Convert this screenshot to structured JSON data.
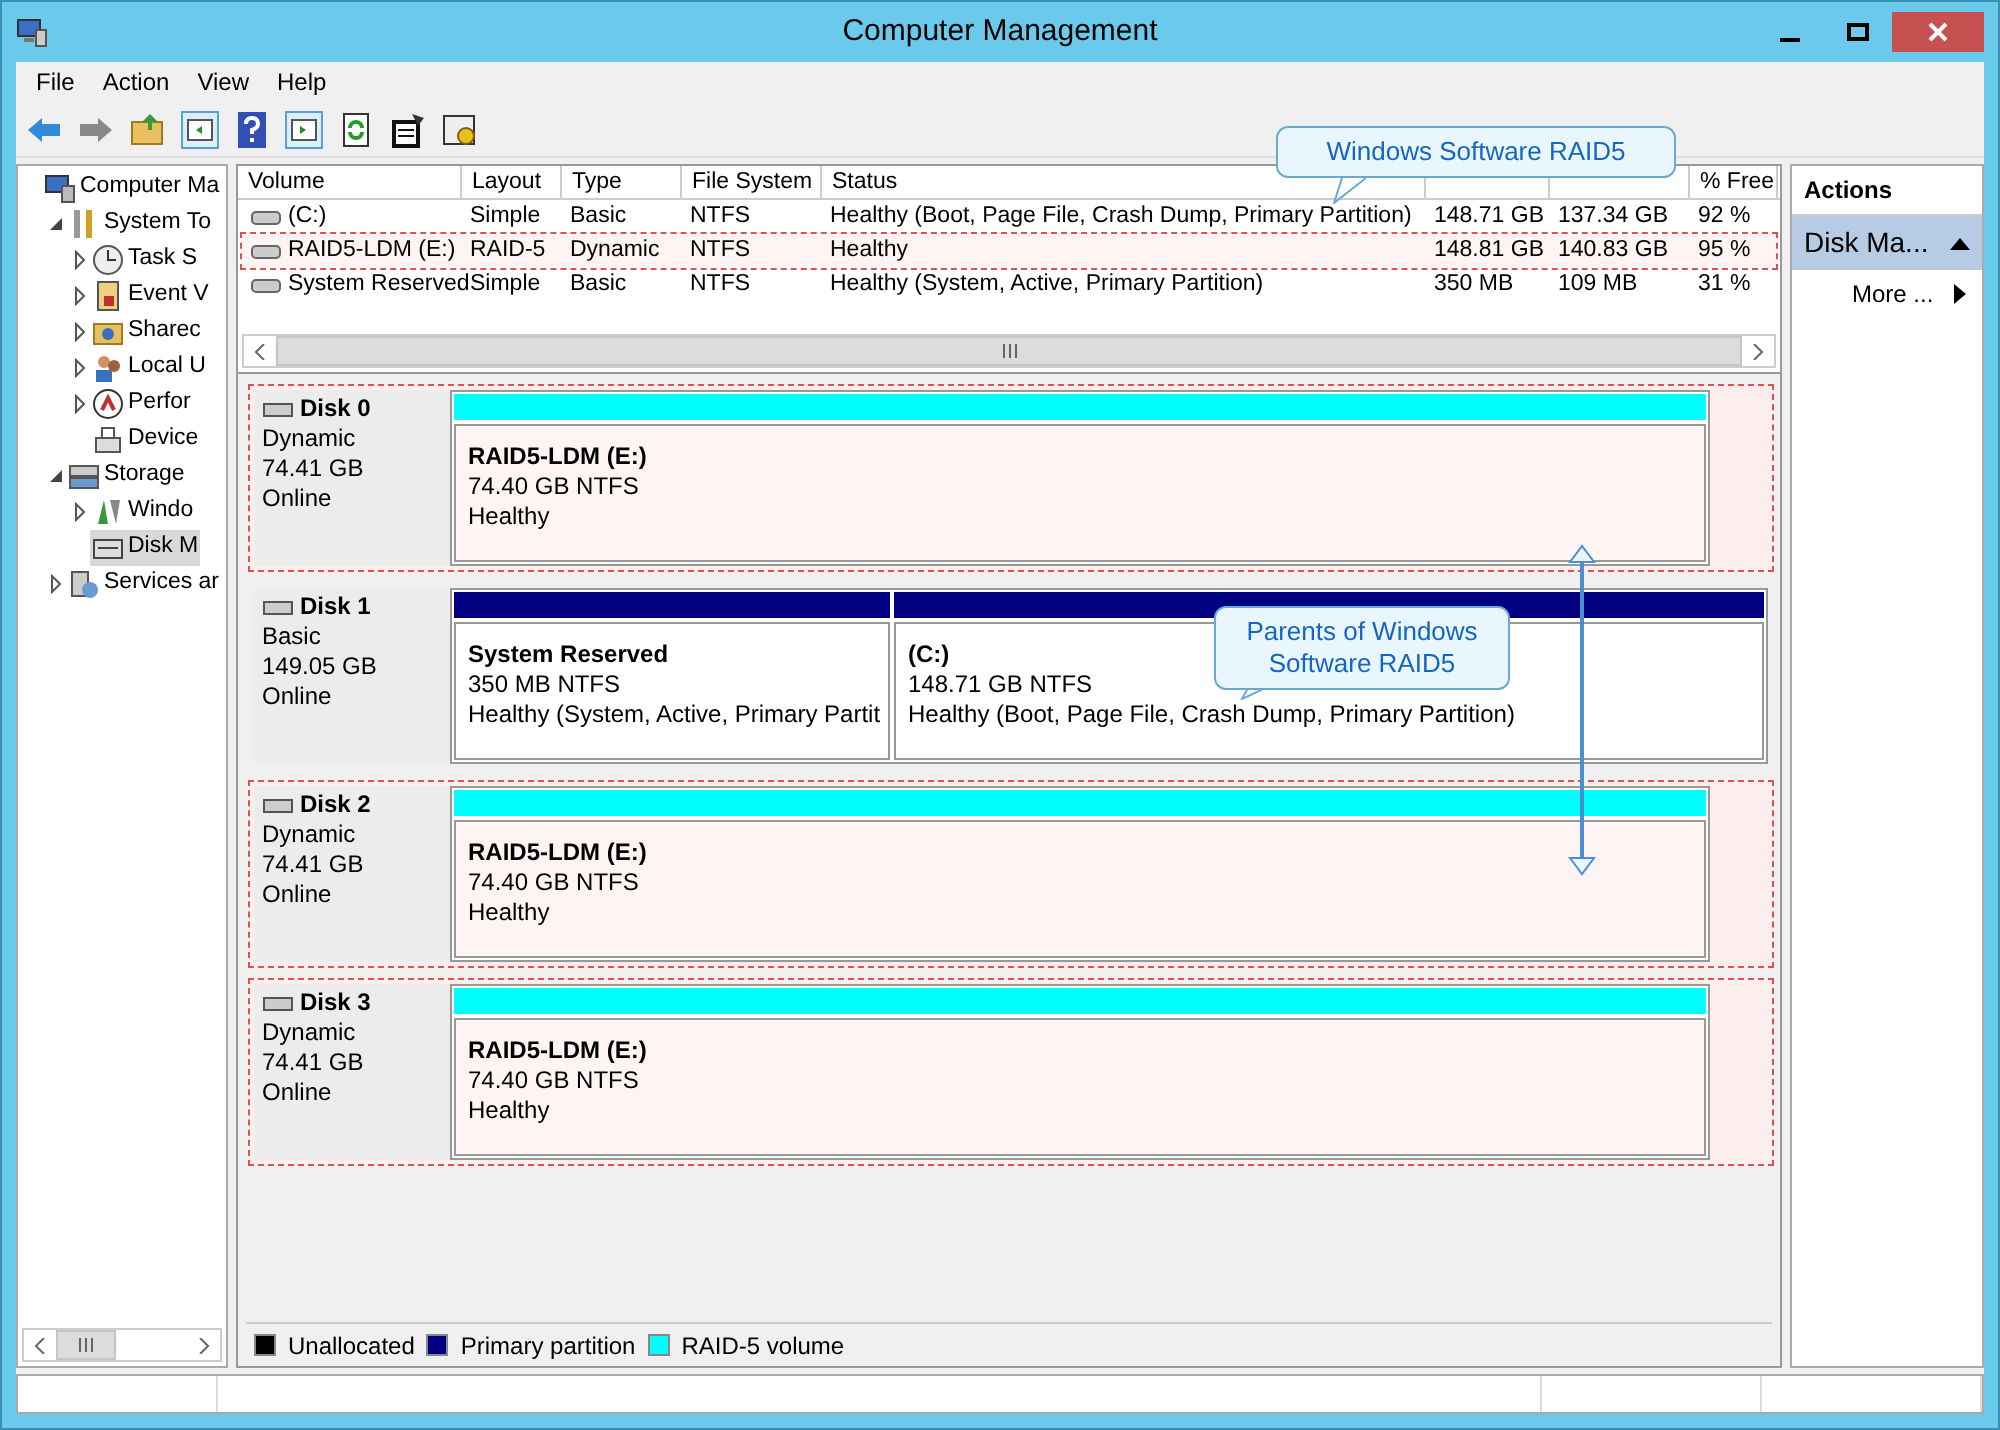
{
  "window": {
    "title": "Computer Management"
  },
  "menu": [
    "File",
    "Action",
    "View",
    "Help"
  ],
  "tree": [
    {
      "label": "Computer Ma",
      "selected": false,
      "children": [
        {
          "label": "System To",
          "expanded": true,
          "selected": false,
          "children": [
            {
              "label": "Task S",
              "expanded": false,
              "selected": false
            },
            {
              "label": "Event V",
              "expanded": false,
              "selected": false
            },
            {
              "label": "Sharec",
              "expanded": false,
              "selected": false
            },
            {
              "label": "Local U",
              "expanded": false,
              "selected": false
            },
            {
              "label": "Perfor",
              "expanded": false,
              "selected": false
            },
            {
              "label": "Device",
              "selected": false
            }
          ]
        },
        {
          "label": "Storage",
          "expanded": true,
          "selected": false,
          "children": [
            {
              "label": "Windo",
              "expanded": false,
              "selected": false
            },
            {
              "label": "Disk M",
              "selected": true
            }
          ]
        },
        {
          "label": "Services ar",
          "expanded": false,
          "selected": false
        }
      ]
    }
  ],
  "volume_table": {
    "columns": [
      "Volume",
      "Layout",
      "Type",
      "File System",
      "Status",
      "",
      "",
      "% Free"
    ],
    "rows": [
      {
        "cells": [
          "(C:)",
          "Simple",
          "Basic",
          "NTFS",
          "Healthy (Boot, Page File, Crash Dump, Primary Partition)",
          "148.71 GB",
          "137.34 GB",
          "92 %"
        ],
        "highlighted": false
      },
      {
        "cells": [
          "RAID5-LDM (E:)",
          "RAID-5",
          "Dynamic",
          "NTFS",
          "Healthy",
          "148.81 GB",
          "140.83 GB",
          "95 %"
        ],
        "highlighted": true
      },
      {
        "cells": [
          "System Reserved",
          "Simple",
          "Basic",
          "NTFS",
          "Healthy (System, Active, Primary Partition)",
          "350 MB",
          "109 MB",
          "31 %"
        ],
        "highlighted": false
      }
    ]
  },
  "disks": [
    {
      "name": "Disk 0",
      "type": "Dynamic",
      "size": "74.41 GB",
      "status": "Online",
      "highlighted": true,
      "partitions": [
        {
          "kind": "raid5",
          "title": "RAID5-LDM  (E:)",
          "size": "74.40 GB NTFS",
          "status": "Healthy"
        }
      ]
    },
    {
      "name": "Disk 1",
      "type": "Basic",
      "size": "149.05 GB",
      "status": "Online",
      "highlighted": false,
      "partitions": [
        {
          "kind": "primary",
          "title": "System Reserved",
          "size": "350 MB NTFS",
          "status": "Healthy (System, Active, Primary Partit"
        },
        {
          "kind": "primary",
          "title": "(C:)",
          "size": "148.71 GB NTFS",
          "status": "Healthy (Boot, Page File, Crash Dump, Primary Partition)"
        }
      ]
    },
    {
      "name": "Disk 2",
      "type": "Dynamic",
      "size": "74.41 GB",
      "status": "Online",
      "highlighted": true,
      "partitions": [
        {
          "kind": "raid5",
          "title": "RAID5-LDM  (E:)",
          "size": "74.40 GB NTFS",
          "status": "Healthy"
        }
      ]
    },
    {
      "name": "Disk 3",
      "type": "Dynamic",
      "size": "74.41 GB",
      "status": "Online",
      "highlighted": true,
      "partitions": [
        {
          "kind": "raid5",
          "title": "RAID5-LDM  (E:)",
          "size": "74.40 GB NTFS",
          "status": "Healthy"
        }
      ]
    }
  ],
  "legend": [
    {
      "label": "Unallocated",
      "color": "#000000"
    },
    {
      "label": "Primary partition",
      "color": "#000080"
    },
    {
      "label": "RAID-5 volume",
      "color": "#00ffff"
    }
  ],
  "actions": {
    "title": "Actions",
    "section": "Disk Ma...",
    "items": [
      "More ..."
    ]
  },
  "callouts": [
    "Windows Software RAID5",
    "Parents of Windows Software RAID5"
  ]
}
